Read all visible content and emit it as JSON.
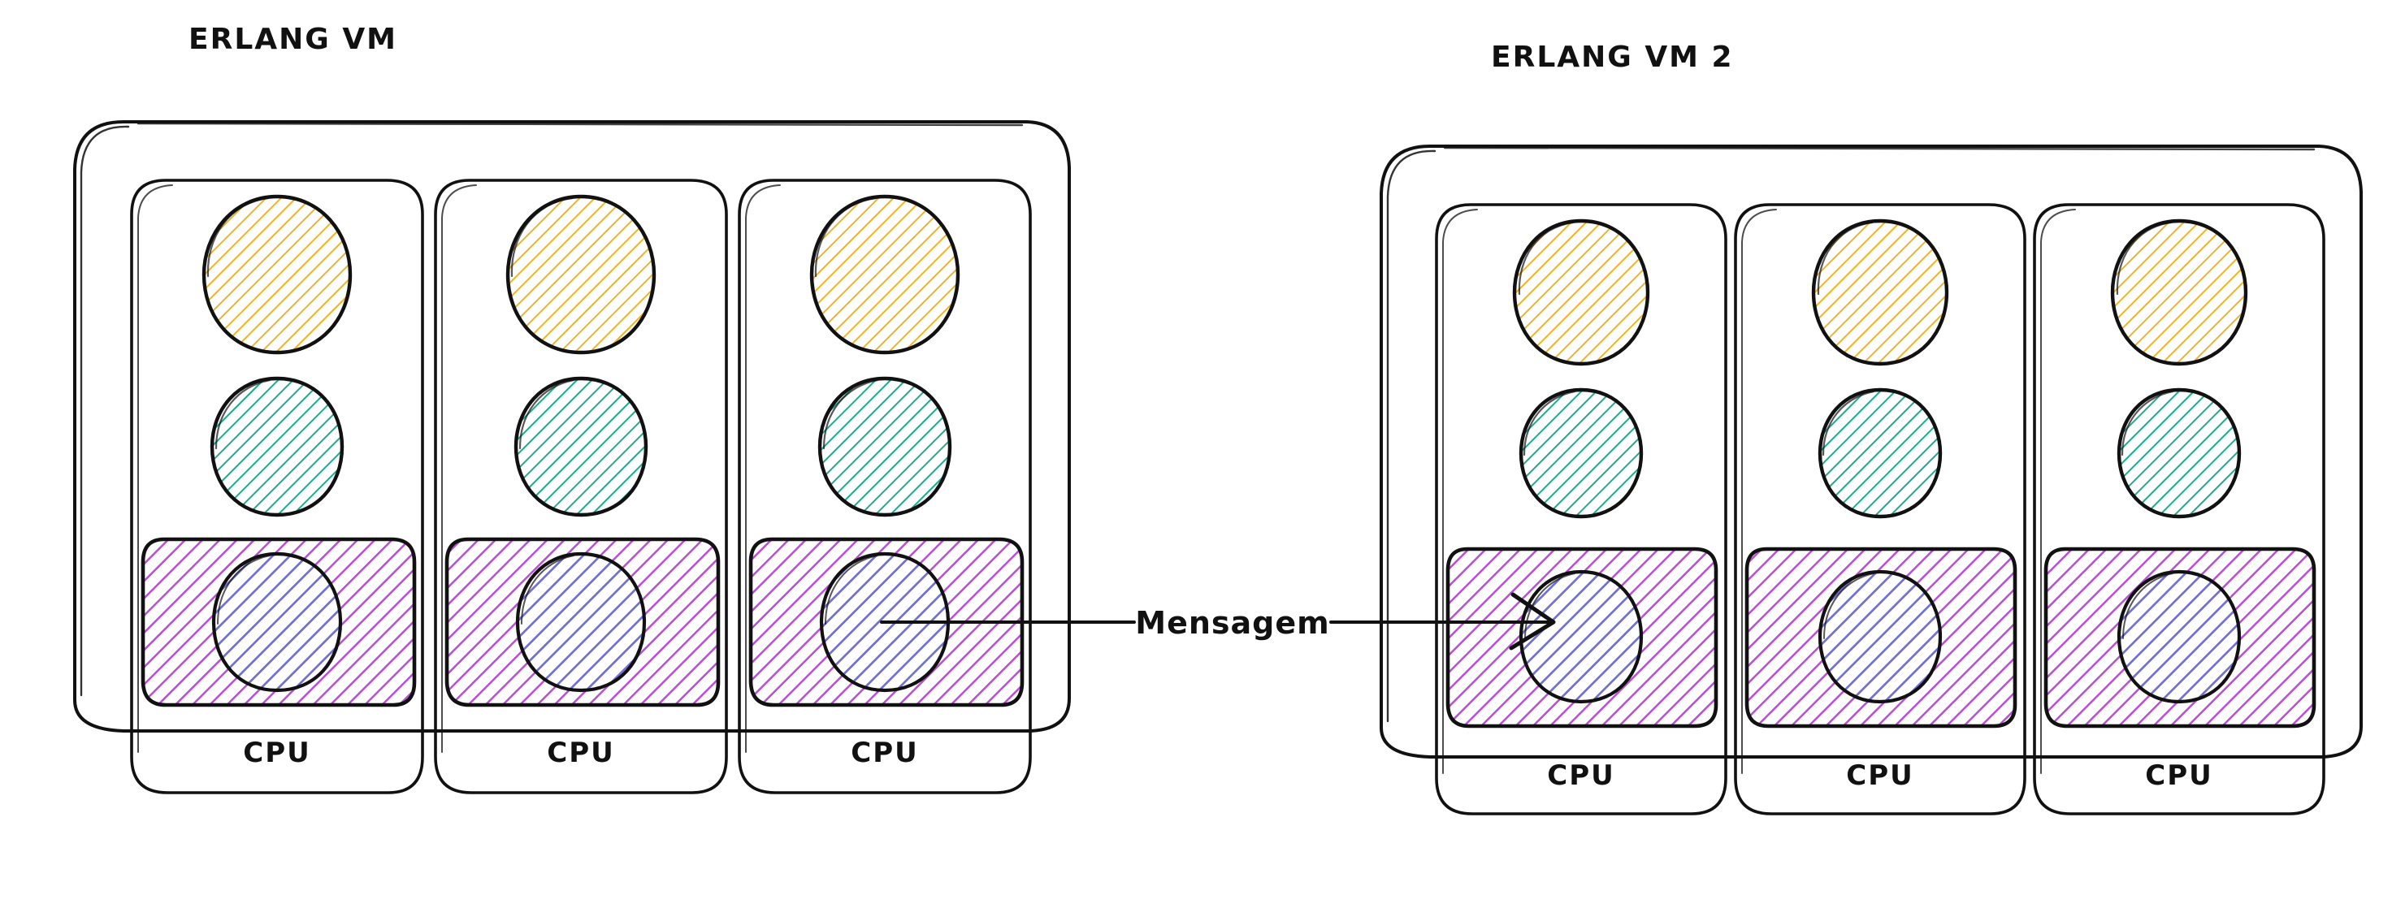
{
  "diagram": {
    "title_left": "ERLANG VM",
    "title_right": "ERLANG VM 2",
    "message_label": "Mensagem",
    "cpu_label": "CPU",
    "colors": {
      "outline": "#111111",
      "yellow_circle": "#f0b429",
      "teal_circle": "#1fab8e",
      "purple_box": "#b94fd4",
      "blue_circle": "#2f8fd4",
      "background": "#ffffff"
    },
    "vms": [
      {
        "id": "erlang-vm-1",
        "title": "ERLANG VM",
        "cpus": [
          {
            "label": "CPU",
            "processes": [
              "yellow-process",
              "teal-process",
              "highlighted-process"
            ]
          },
          {
            "label": "CPU",
            "processes": [
              "yellow-process",
              "teal-process",
              "highlighted-process"
            ]
          },
          {
            "label": "CPU",
            "processes": [
              "yellow-process",
              "teal-process",
              "highlighted-process"
            ]
          }
        ]
      },
      {
        "id": "erlang-vm-2",
        "title": "ERLANG VM 2",
        "cpus": [
          {
            "label": "CPU",
            "processes": [
              "yellow-process",
              "teal-process",
              "highlighted-process"
            ]
          },
          {
            "label": "CPU",
            "processes": [
              "yellow-process",
              "teal-process",
              "highlighted-process"
            ]
          },
          {
            "label": "CPU",
            "processes": [
              "yellow-process",
              "teal-process",
              "highlighted-process"
            ]
          }
        ]
      }
    ],
    "message_arrow": {
      "label": "Mensagem",
      "from": "erlang-vm-1 cpu-3 highlighted-process",
      "to": "erlang-vm-2 cpu-1 highlighted-process",
      "direction": "right"
    }
  }
}
